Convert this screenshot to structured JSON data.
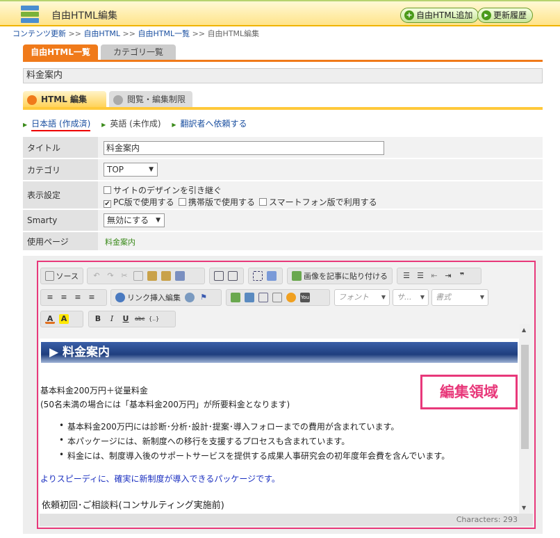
{
  "header": {
    "title": "自由HTML編集",
    "add_button": "自由HTML追加",
    "history_button": "更新履歴"
  },
  "breadcrumb": [
    "コンテンツ更新",
    "自由HTML",
    "自由HTML一覧",
    "自由HTML編集"
  ],
  "tabs": [
    "自由HTML一覧",
    "カテゴリ一覧"
  ],
  "page_name": "料金案内",
  "subtabs": [
    "HTML 編集",
    "閲覧・編集制限"
  ],
  "languages": [
    "日本語 (作成済)",
    "英語 (未作成)",
    "翻訳者へ依頼する"
  ],
  "form": {
    "title_label": "タイトル",
    "title_value": "料金案内",
    "category_label": "カテゴリ",
    "category_value": "TOP",
    "display_label": "表示設定",
    "display_options": [
      "サイトのデザインを引き継ぐ",
      "PC版で使用する",
      "携帯版で使用する",
      "スマートフォン版で利用する"
    ],
    "smarty_label": "Smarty",
    "smarty_value": "無効にする",
    "used_page_label": "使用ページ",
    "used_page_value": "料金案内"
  },
  "toolbar": {
    "source": "ソース",
    "paste_image": "画像を記事に貼り付ける",
    "link_insert": "リンク挿入編集",
    "font": "フォント",
    "size": "サ...",
    "format": "書式"
  },
  "content": {
    "heading": "▶ 料金案内",
    "line1": "基本料金200万円＋従量料金",
    "line2": "(50名未満の場合には「基本料金200万円」が所要料金となります)",
    "bullets": [
      "基本料金200万円には診断･分析･設計･提案･導入フォローまでの費用が含まれています。",
      "本パッケージには、新制度への移行を支援するプロセスも含まれています。",
      "料金には、制度導入後のサポートサービスを提供する成果人事研究会の初年度年会費を含んでいます。"
    ],
    "blue_line": "よりスピーディに、確実に新制度が導入できるパッケージです。",
    "line3": "依頼初回･ご相談料(コンサルティング実施前)"
  },
  "status": "Characters: 293",
  "annotation_label": "編集領域",
  "colors": {
    "accent_orange": "#f07a1a",
    "annotation_pink": "#e8387a",
    "link_blue": "#1a4fa0"
  }
}
